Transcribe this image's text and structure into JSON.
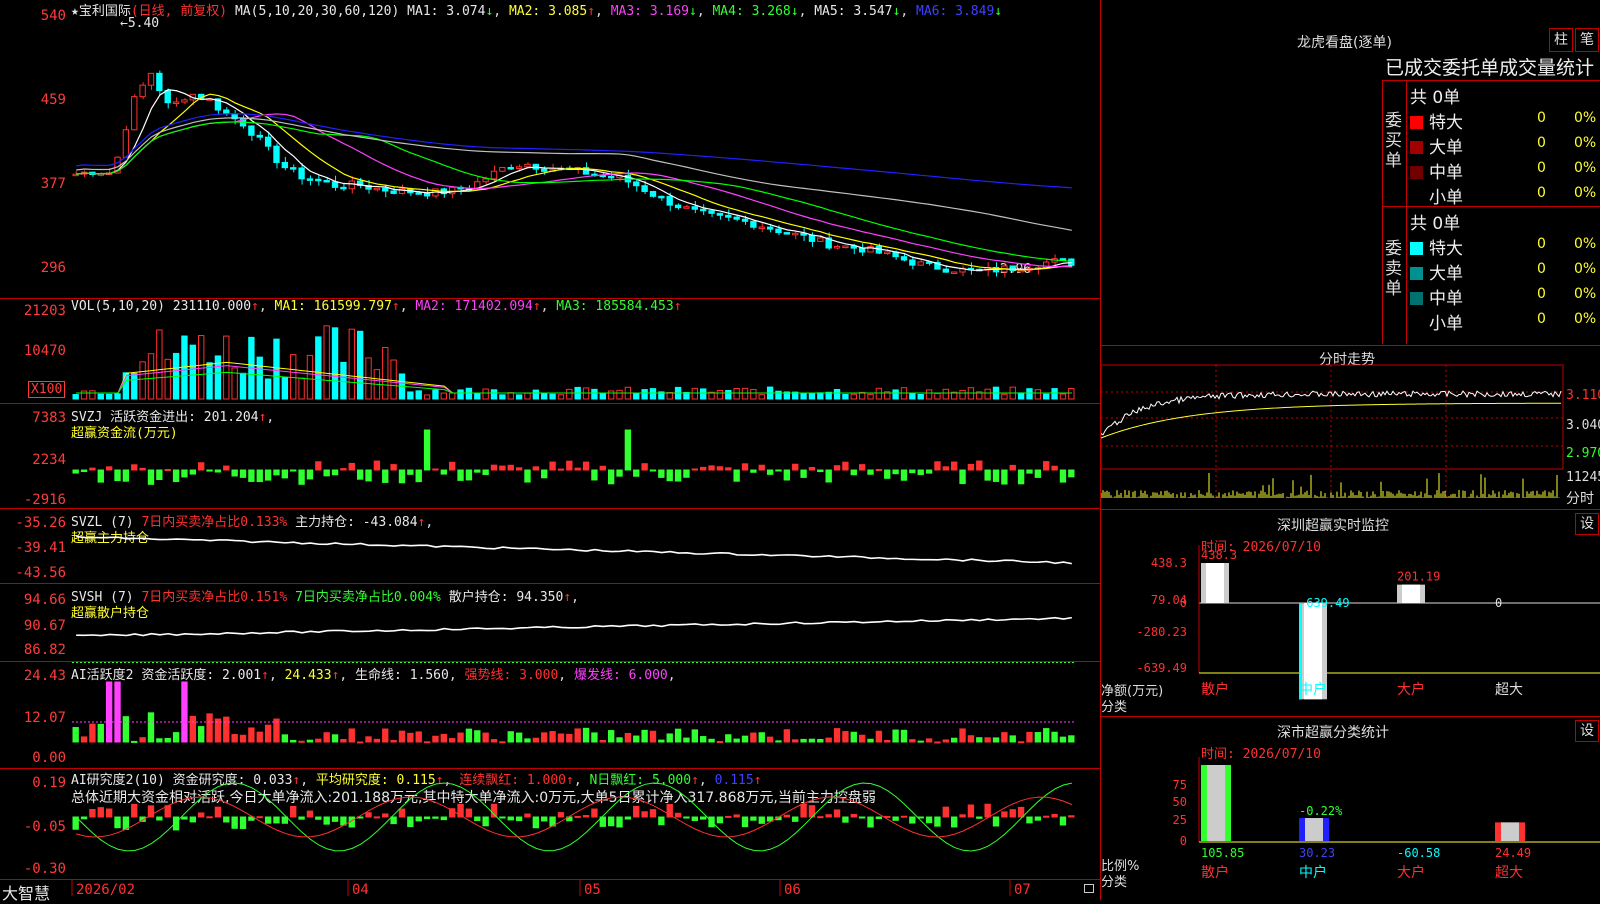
{
  "colors": {
    "up": "#ff3030",
    "down": "#00ffff",
    "ma1": "#ffffff",
    "ma2": "#ffff00",
    "ma3": "#ff40ff",
    "ma4": "#00ff00",
    "ma5": "#c0c0c0",
    "ma6": "#2020ff",
    "grid": "#c00000"
  },
  "header": {
    "stock": "★宝利国际",
    "period": "(日线, 前复权)",
    "ma_label": "MA(5,10,20,30,60,120)",
    "ma1": "MA1: 3.074",
    "ma2": "MA2: 3.085",
    "ma3": "MA3: 3.169",
    "ma4": "MA4: 3.268",
    "ma5": "MA5: 3.547",
    "ma6": "MA6: 3.849",
    "high_mark": "5.40",
    "low_mark": "2.96"
  },
  "price_axis": [
    "540",
    "459",
    "377",
    "296"
  ],
  "vol": {
    "label": "VOL(5,10,20)",
    "v": "231110.000",
    "ma1": "MA1: 161599.797",
    "ma2": "MA2: 171402.094",
    "ma3": "MA3: 185584.453",
    "axis": [
      "21203",
      "10470"
    ],
    "unit": "X100"
  },
  "svzj": {
    "label": "SVZJ  活跃资金进出: 201.204",
    "sub": "超赢资金流(万元)",
    "axis": [
      "7383",
      "2234",
      "-2916"
    ]
  },
  "svzl": {
    "label": "SVZL (7)",
    "a": "7日内买卖净占比0.133%",
    "b": "主力持仓: -43.084",
    "sub": "超赢主力持仓",
    "axis": [
      "-35.26",
      "-39.41",
      "-43.56"
    ]
  },
  "svsh": {
    "label": "SVSH (7)",
    "a": "7日内买卖净占比0.151%",
    "b": "7日内买卖净占比0.004%",
    "c": "散户持仓: 94.350",
    "sub": "超赢散户持仓",
    "axis": [
      "94.66",
      "90.67",
      "86.82"
    ]
  },
  "ai1": {
    "label": "AI活跃度2",
    "a": "资金活跃度: 2.001",
    "b": "24.433",
    "c": "生命线: 1.560",
    "d": "强势线: 3.000",
    "e": "爆发线: 6.000",
    "axis": [
      "24.43",
      "12.07",
      "0.00"
    ]
  },
  "ai2": {
    "label": "AI研究度2(10)",
    "a": "资金研究度: 0.033",
    "b": "平均研究度: 0.115",
    "c": "连续飘红: 1.000",
    "d": "N日飘红: 5.000",
    "e": "0.115",
    "summary": "总体近期大资金相对活跃,今日大单净流入:201.188万元,其中特大单净流入:0万元,大单5日累计净入317.868万元,当前主力控盘弱",
    "axis": [
      "0.19",
      "-0.05",
      "-0.30"
    ]
  },
  "date_axis": {
    "brand": "大智慧",
    "labels": [
      "2026/02",
      "04",
      "05",
      "06",
      "07"
    ]
  },
  "right": {
    "lhb_title": "龙虎看盘(逐单)",
    "btn1": "柱",
    "btn2": "笔",
    "table_title": "已成交委托单成交量统计",
    "buy_side": "委买单",
    "sell_side": "委卖单",
    "buy_total": "共 0单",
    "sell_total": "共 0单",
    "buy_rows": [
      {
        "name": "特大",
        "count": "0",
        "pct": "0%",
        "color": "#ff0000"
      },
      {
        "name": "大单",
        "count": "0",
        "pct": "0%",
        "color": "#a00000"
      },
      {
        "name": "中单",
        "count": "0",
        "pct": "0%",
        "color": "#700000"
      },
      {
        "name": "小单",
        "count": "0",
        "pct": "0%",
        "color": ""
      }
    ],
    "sell_rows": [
      {
        "name": "特大",
        "count": "0",
        "pct": "0%",
        "color": "#00ffff"
      },
      {
        "name": "大单",
        "count": "0",
        "pct": "0%",
        "color": "#009090"
      },
      {
        "name": "中单",
        "count": "0",
        "pct": "0%",
        "color": "#007070"
      },
      {
        "name": "小单",
        "count": "0",
        "pct": "0%",
        "color": ""
      }
    ],
    "intraday_title": "分时走势",
    "intraday_axis": [
      "3.110",
      "3.040",
      "2.970"
    ],
    "intraday_vol": "11245",
    "intraday_unit": "分时",
    "sz_title": "深圳超赢实时监控",
    "sz_time": "时间: 2026/07/10",
    "set_label": "设",
    "sz_axis": [
      "438.3",
      "79.04",
      "0",
      "-280.23",
      "-639.49"
    ],
    "sz_unit": "净额(万元)",
    "sz_cat_label": "分类",
    "sz_bars": [
      {
        "label": "散户",
        "value": 438.3,
        "text": "438.3"
      },
      {
        "label": "中户",
        "value": -639.49,
        "text": "-639.49"
      },
      {
        "label": "大户",
        "value": 201.19,
        "text": "201.19"
      },
      {
        "label": "超大",
        "value": 0,
        "text": "0"
      }
    ],
    "cls_title": "深市超赢分类统计",
    "cls_time": "时间: 2026/07/10",
    "cls_axis": [
      "75",
      "50",
      "25",
      "0"
    ],
    "cls_unit": "比例%",
    "cls_cat_label": "分类",
    "cls_bars": [
      {
        "label": "散户",
        "value": 105.85,
        "text": "105.85"
      },
      {
        "label": "中户",
        "value": 30.23,
        "text": "30.23",
        "top": "-0.22%"
      },
      {
        "label": "大户",
        "value": -60.58,
        "text": "-60.58"
      },
      {
        "label": "超大",
        "value": 24.49,
        "text": "24.49"
      }
    ]
  }
}
